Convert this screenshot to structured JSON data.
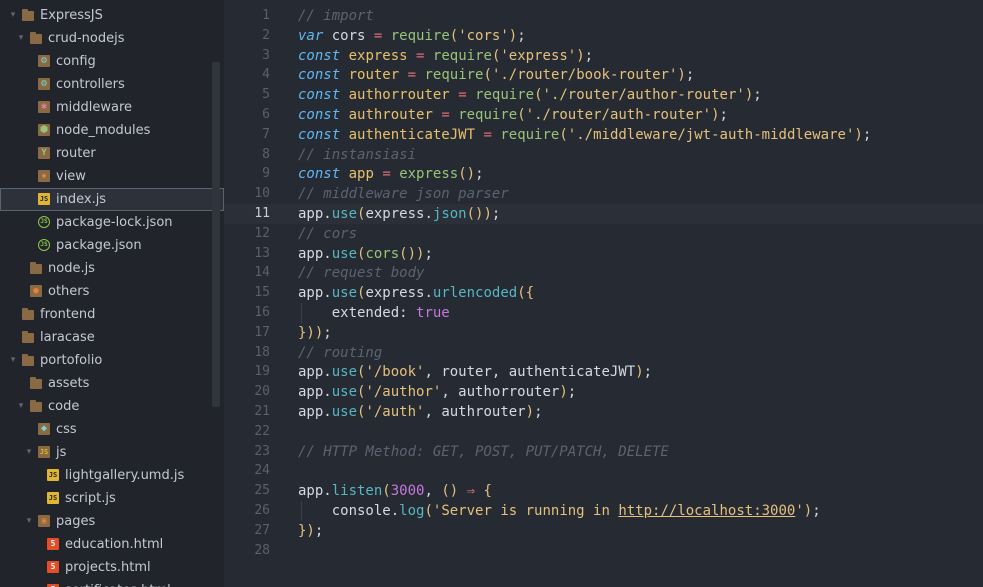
{
  "sidebar": {
    "items": [
      {
        "label": "ExpressJS",
        "icon": "folder-open-icon",
        "arrow": "▾",
        "depth": 0
      },
      {
        "label": "crud-nodejs",
        "icon": "folder-open-icon",
        "arrow": "▾",
        "depth": 1
      },
      {
        "label": "config",
        "icon": "config-folder-icon",
        "arrow": "",
        "depth": 2
      },
      {
        "label": "controllers",
        "icon": "config-folder-icon",
        "arrow": "",
        "depth": 2
      },
      {
        "label": "middleware",
        "icon": "middleware-folder-icon",
        "arrow": "",
        "depth": 2
      },
      {
        "label": "node_modules",
        "icon": "nodejs-folder-icon",
        "arrow": "",
        "depth": 2
      },
      {
        "label": "router",
        "icon": "router-folder-icon",
        "arrow": "",
        "depth": 2
      },
      {
        "label": "view",
        "icon": "view-folder-icon",
        "arrow": "",
        "depth": 2
      },
      {
        "label": "index.js",
        "icon": "js-file-icon",
        "arrow": "",
        "depth": 2,
        "active": true
      },
      {
        "label": "package-lock.json",
        "icon": "nodejs-file-icon",
        "arrow": "",
        "depth": 2
      },
      {
        "label": "package.json",
        "icon": "nodejs-file-icon",
        "arrow": "",
        "depth": 2
      },
      {
        "label": "node.js",
        "icon": "folder-icon",
        "arrow": "",
        "depth": 1
      },
      {
        "label": "others",
        "icon": "others-folder-icon",
        "arrow": "",
        "depth": 1
      },
      {
        "label": "frontend",
        "icon": "folder-icon",
        "arrow": "",
        "depth": 0
      },
      {
        "label": "laracase",
        "icon": "folder-icon",
        "arrow": "",
        "depth": 0
      },
      {
        "label": "portofolio",
        "icon": "folder-open-icon",
        "arrow": "▾",
        "depth": 0
      },
      {
        "label": "assets",
        "icon": "folder-icon",
        "arrow": "",
        "depth": 1
      },
      {
        "label": "code",
        "icon": "folder-open-icon",
        "arrow": "▾",
        "depth": 1
      },
      {
        "label": "css",
        "icon": "css-folder-icon",
        "arrow": "",
        "depth": 2
      },
      {
        "label": "js",
        "icon": "js-folder-icon",
        "arrow": "▾",
        "depth": 2
      },
      {
        "label": "lightgallery.umd.js",
        "icon": "js-file-icon",
        "arrow": "",
        "depth": 3
      },
      {
        "label": "script.js",
        "icon": "js-file-icon",
        "arrow": "",
        "depth": 3
      },
      {
        "label": "pages",
        "icon": "pages-folder-icon",
        "arrow": "▾",
        "depth": 2
      },
      {
        "label": "education.html",
        "icon": "html-file-icon",
        "arrow": "",
        "depth": 3
      },
      {
        "label": "projects.html",
        "icon": "html-file-icon",
        "arrow": "",
        "depth": 3
      },
      {
        "label": "sertificates.html",
        "icon": "html-file-icon",
        "arrow": "",
        "depth": 3
      }
    ]
  },
  "editor": {
    "current_line": 11,
    "lines": [
      [
        [
          "cmt",
          "// import"
        ]
      ],
      [
        [
          "kw",
          "var"
        ],
        [
          "pl",
          " cors "
        ],
        [
          "op",
          "="
        ],
        [
          "pl",
          " "
        ],
        [
          "fn",
          "require"
        ],
        [
          "pn",
          "("
        ],
        [
          "str",
          "'cors'"
        ],
        [
          "pn",
          ")"
        ],
        [
          "pl",
          ";"
        ]
      ],
      [
        [
          "kw",
          "const"
        ],
        [
          "pl",
          " "
        ],
        [
          "var",
          "express"
        ],
        [
          "pl",
          " "
        ],
        [
          "op",
          "="
        ],
        [
          "pl",
          " "
        ],
        [
          "fn",
          "require"
        ],
        [
          "pn",
          "("
        ],
        [
          "str",
          "'express'"
        ],
        [
          "pn",
          ")"
        ],
        [
          "pl",
          ";"
        ]
      ],
      [
        [
          "kw",
          "const"
        ],
        [
          "pl",
          " "
        ],
        [
          "var",
          "router"
        ],
        [
          "pl",
          " "
        ],
        [
          "op",
          "="
        ],
        [
          "pl",
          " "
        ],
        [
          "fn",
          "require"
        ],
        [
          "pn",
          "("
        ],
        [
          "str",
          "'./router/book-router'"
        ],
        [
          "pn",
          ")"
        ],
        [
          "pl",
          ";"
        ]
      ],
      [
        [
          "kw",
          "const"
        ],
        [
          "pl",
          " "
        ],
        [
          "var",
          "authorrouter"
        ],
        [
          "pl",
          " "
        ],
        [
          "op",
          "="
        ],
        [
          "pl",
          " "
        ],
        [
          "fn",
          "require"
        ],
        [
          "pn",
          "("
        ],
        [
          "str",
          "'./router/author-router'"
        ],
        [
          "pn",
          ")"
        ],
        [
          "pl",
          ";"
        ]
      ],
      [
        [
          "kw",
          "const"
        ],
        [
          "pl",
          " "
        ],
        [
          "var",
          "authrouter"
        ],
        [
          "pl",
          " "
        ],
        [
          "op",
          "="
        ],
        [
          "pl",
          " "
        ],
        [
          "fn",
          "require"
        ],
        [
          "pn",
          "("
        ],
        [
          "str",
          "'./router/auth-router'"
        ],
        [
          "pn",
          ")"
        ],
        [
          "pl",
          ";"
        ]
      ],
      [
        [
          "kw",
          "const"
        ],
        [
          "pl",
          " "
        ],
        [
          "var",
          "authenticateJWT"
        ],
        [
          "pl",
          " "
        ],
        [
          "op",
          "="
        ],
        [
          "pl",
          " "
        ],
        [
          "fn",
          "require"
        ],
        [
          "pn",
          "("
        ],
        [
          "str",
          "'./middleware/jwt-auth-middleware'"
        ],
        [
          "pn",
          ")"
        ],
        [
          "pl",
          ";"
        ]
      ],
      [
        [
          "cmt",
          "// instansiasi"
        ]
      ],
      [
        [
          "kw",
          "const"
        ],
        [
          "pl",
          " "
        ],
        [
          "var",
          "app"
        ],
        [
          "pl",
          " "
        ],
        [
          "op",
          "="
        ],
        [
          "pl",
          " "
        ],
        [
          "fn",
          "express"
        ],
        [
          "pn",
          "()"
        ],
        [
          "pl",
          ";"
        ]
      ],
      [
        [
          "cmt",
          "// middleware json parser"
        ]
      ],
      [
        [
          "pl",
          "app."
        ],
        [
          "mt",
          "use"
        ],
        [
          "pn",
          "("
        ],
        [
          "pl",
          "express."
        ],
        [
          "mt",
          "json"
        ],
        [
          "pn",
          "())"
        ],
        [
          "pl",
          ";"
        ]
      ],
      [
        [
          "cmt",
          "// cors"
        ]
      ],
      [
        [
          "pl",
          "app."
        ],
        [
          "mt",
          "use"
        ],
        [
          "pn",
          "("
        ],
        [
          "fn",
          "cors"
        ],
        [
          "pn",
          "())"
        ],
        [
          "pl",
          ";"
        ]
      ],
      [
        [
          "cmt",
          "// request body"
        ]
      ],
      [
        [
          "pl",
          "app."
        ],
        [
          "mt",
          "use"
        ],
        [
          "pn",
          "("
        ],
        [
          "pl",
          "express."
        ],
        [
          "mt",
          "urlencoded"
        ],
        [
          "pn",
          "({"
        ]
      ],
      [
        [
          "pl",
          "    "
        ],
        [
          "prop",
          "extended"
        ],
        [
          "pl",
          ": "
        ],
        [
          "num",
          "true"
        ]
      ],
      [
        [
          "pn",
          "}))"
        ],
        [
          "pl",
          ";"
        ]
      ],
      [
        [
          "cmt",
          "// routing"
        ]
      ],
      [
        [
          "pl",
          "app."
        ],
        [
          "mt",
          "use"
        ],
        [
          "pn",
          "("
        ],
        [
          "str",
          "'/book'"
        ],
        [
          "pl",
          ", router, authenticateJWT"
        ],
        [
          "pn",
          ")"
        ],
        [
          "pl",
          ";"
        ]
      ],
      [
        [
          "pl",
          "app."
        ],
        [
          "mt",
          "use"
        ],
        [
          "pn",
          "("
        ],
        [
          "str",
          "'/author'"
        ],
        [
          "pl",
          ", authorrouter"
        ],
        [
          "pn",
          ")"
        ],
        [
          "pl",
          ";"
        ]
      ],
      [
        [
          "pl",
          "app."
        ],
        [
          "mt",
          "use"
        ],
        [
          "pn",
          "("
        ],
        [
          "str",
          "'/auth'"
        ],
        [
          "pl",
          ", authrouter"
        ],
        [
          "pn",
          ")"
        ],
        [
          "pl",
          ";"
        ]
      ],
      [],
      [
        [
          "cmt",
          "// HTTP Method: GET, POST, PUT/PATCH, DELETE"
        ]
      ],
      [],
      [
        [
          "pl",
          "app."
        ],
        [
          "mt",
          "listen"
        ],
        [
          "pn",
          "("
        ],
        [
          "num",
          "3000"
        ],
        [
          "pl",
          ", "
        ],
        [
          "pn",
          "()"
        ],
        [
          "pl",
          " "
        ],
        [
          "op",
          "⇒"
        ],
        [
          "pl",
          " "
        ],
        [
          "pn",
          "{"
        ]
      ],
      [
        [
          "pl",
          "    console."
        ],
        [
          "mt",
          "log"
        ],
        [
          "pn",
          "("
        ],
        [
          "str",
          "'Server is running in "
        ],
        [
          "url",
          "http://localhost:3000"
        ],
        [
          "str",
          "'"
        ],
        [
          "pn",
          ")"
        ],
        [
          "pl",
          ";"
        ]
      ],
      [
        [
          "pn",
          "})"
        ],
        [
          "pl",
          ";"
        ]
      ],
      []
    ]
  }
}
